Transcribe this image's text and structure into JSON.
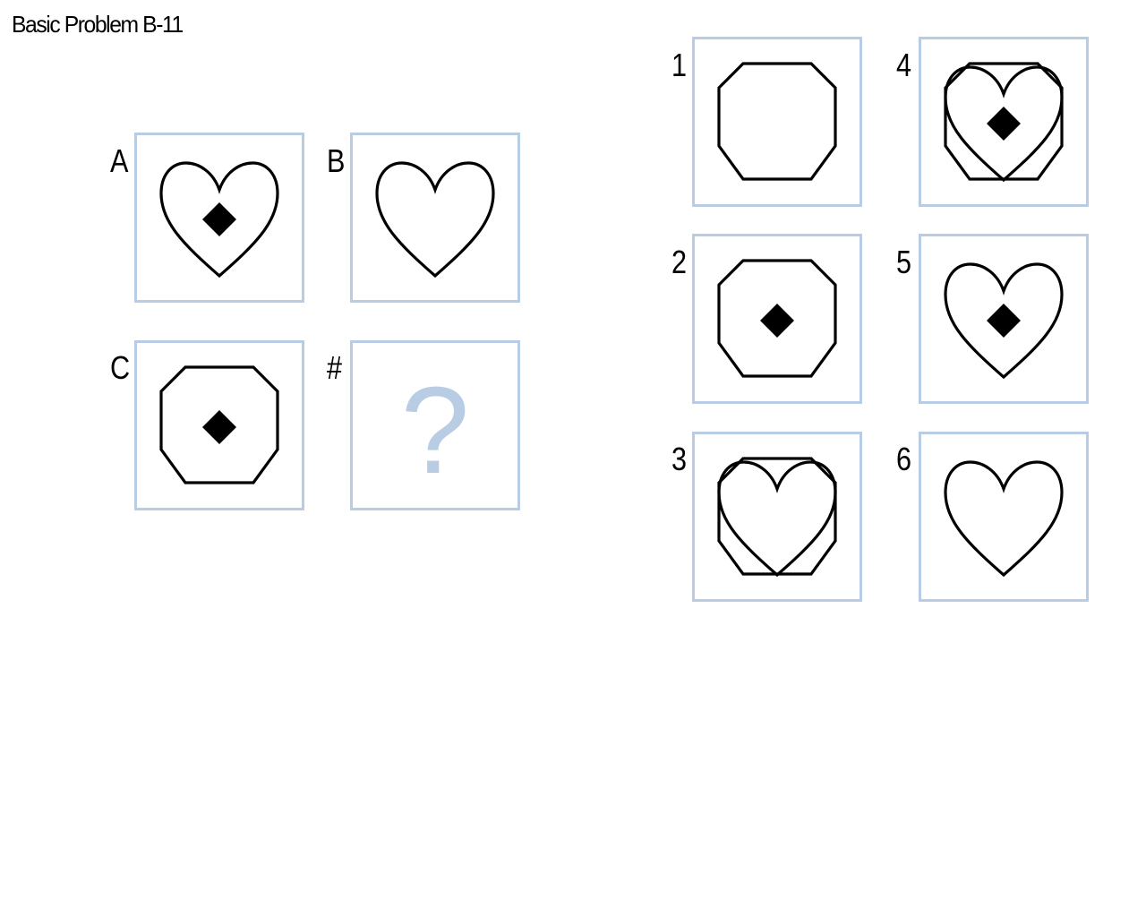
{
  "title": "Basic Problem B-11",
  "colors": {
    "frame": "#b8cce4",
    "question_mark": "#b8cce4",
    "shape_stroke": "#000000"
  },
  "matrix": {
    "cells": [
      {
        "label": "A",
        "shapes": [
          "heart-icon",
          "diamond-icon"
        ]
      },
      {
        "label": "B",
        "shapes": [
          "heart-icon"
        ]
      },
      {
        "label": "C",
        "shapes": [
          "octagon-icon",
          "diamond-icon"
        ]
      },
      {
        "label": "#",
        "question": "?"
      }
    ]
  },
  "answers": [
    {
      "label": "1",
      "shapes": [
        "octagon-icon"
      ]
    },
    {
      "label": "2",
      "shapes": [
        "octagon-icon",
        "diamond-icon"
      ]
    },
    {
      "label": "3",
      "shapes": [
        "octagon-icon",
        "heart-icon"
      ]
    },
    {
      "label": "4",
      "shapes": [
        "octagon-icon",
        "heart-icon",
        "diamond-icon"
      ]
    },
    {
      "label": "5",
      "shapes": [
        "heart-icon",
        "diamond-icon"
      ]
    },
    {
      "label": "6",
      "shapes": [
        "heart-icon"
      ]
    }
  ]
}
